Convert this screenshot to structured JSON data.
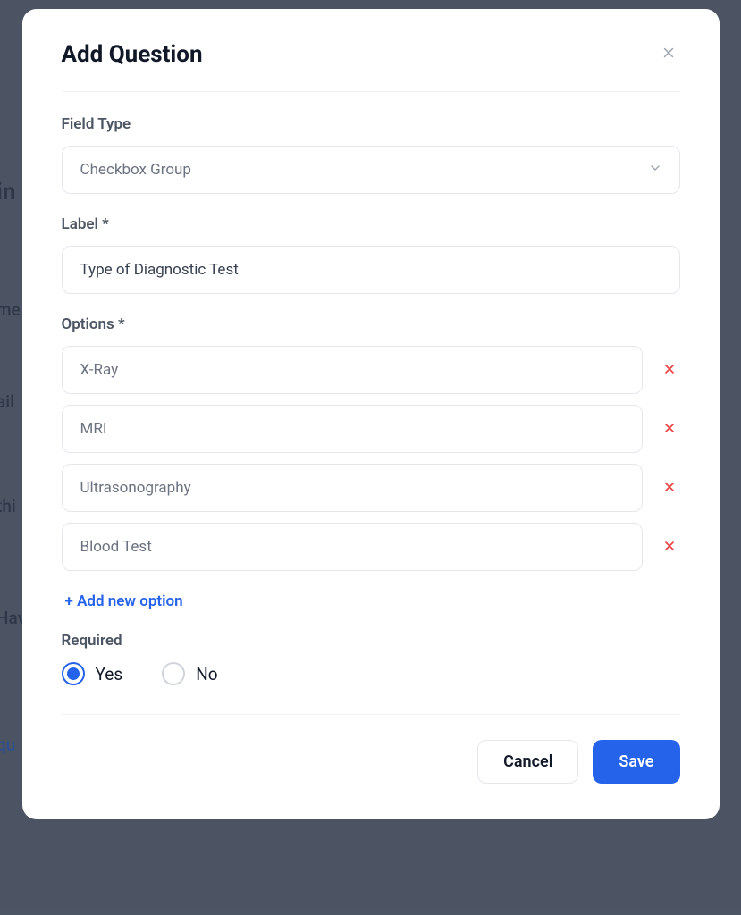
{
  "modal": {
    "title": "Add Question",
    "fieldType": {
      "label": "Field Type",
      "value": "Checkbox Group"
    },
    "labelField": {
      "label": "Label *",
      "value": "Type of Diagnostic Test"
    },
    "options": {
      "label": "Options *",
      "items": [
        "X-Ray",
        "MRI",
        "Ultrasonography",
        "Blood Test"
      ],
      "addLabel": "+ Add new option"
    },
    "required": {
      "label": "Required",
      "yes": "Yes",
      "no": "No",
      "selected": "yes"
    },
    "footer": {
      "cancel": "Cancel",
      "save": "Save"
    }
  },
  "background": {
    "fragments": [
      "in",
      "me",
      "ail",
      "thi",
      "Hav",
      "qu"
    ]
  }
}
